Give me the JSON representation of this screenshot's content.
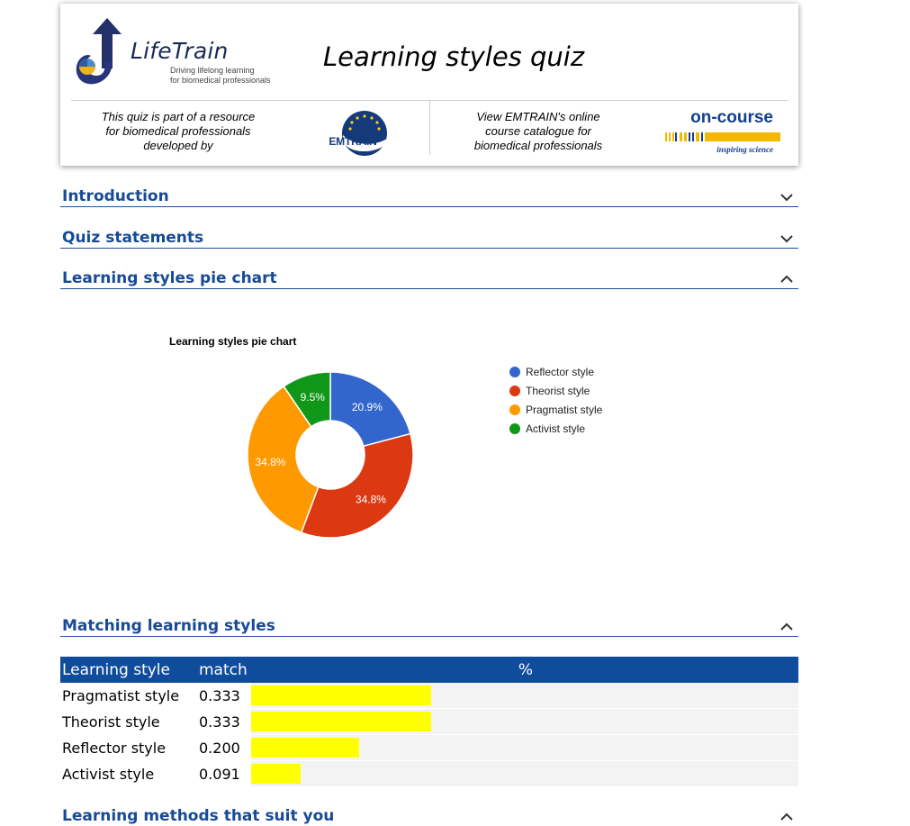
{
  "header": {
    "logo_name": "LifeTrain",
    "logo_tagline_1": "Driving lifelong learning",
    "logo_tagline_2": "for biomedical professionals",
    "title": "Learning styles quiz",
    "part_text_1": "This quiz is part of a resource",
    "part_text_2": "for biomedical professionals",
    "part_text_3": "developed by",
    "emtrain_label": "EMTRAIN",
    "view_text_1": "View EMTRAIN's online",
    "view_text_2": "course catalogue for",
    "view_text_3": "biomedical professionals",
    "oncourse_label": "on-course",
    "oncourse_tagline": "inspiring science"
  },
  "sections": {
    "introduction": "Introduction",
    "quiz_statements": "Quiz statements",
    "pie_chart": "Learning styles pie chart",
    "matching": "Matching learning styles",
    "methods": "Learning methods that suit you"
  },
  "chart_data": {
    "type": "pie",
    "title": "Learning styles pie chart",
    "donut": true,
    "legend_position": "right",
    "slices": [
      {
        "label": "Reflector style",
        "value": 20.9,
        "display": "20.9%",
        "color": "#3366cc"
      },
      {
        "label": "Theorist style",
        "value": 34.8,
        "display": "34.8%",
        "color": "#dc3912"
      },
      {
        "label": "Pragmatist style",
        "value": 34.8,
        "display": "34.8%",
        "color": "#ff9900"
      },
      {
        "label": "Activist style",
        "value": 9.5,
        "display": "9.5%",
        "color": "#109618"
      }
    ]
  },
  "match_table": {
    "headers": [
      "Learning style",
      "match",
      "%"
    ],
    "rows": [
      {
        "style": "Pragmatist style",
        "match": "0.333",
        "fraction": 0.333
      },
      {
        "style": "Theorist style",
        "match": "0.333",
        "fraction": 0.333
      },
      {
        "style": "Reflector style",
        "match": "0.200",
        "fraction": 0.2
      },
      {
        "style": "Activist style",
        "match": "0.091",
        "fraction": 0.091
      }
    ]
  }
}
